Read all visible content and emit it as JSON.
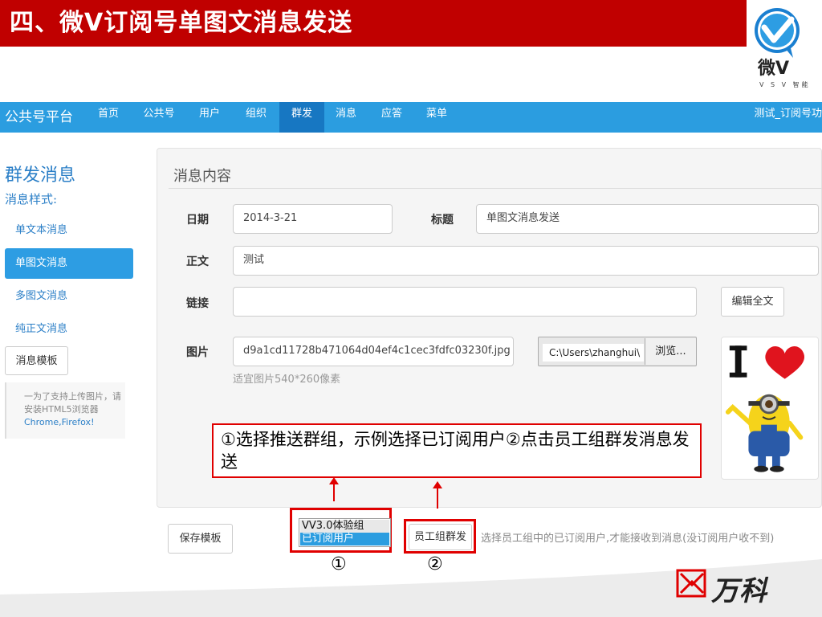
{
  "banner": {
    "title": "四、微V订阅号单图文消息发送"
  },
  "logo": {
    "text": "微V",
    "subtext": "V S V 智能"
  },
  "nav": {
    "brand": "公共号平台",
    "items": [
      "首页",
      "公共号",
      "用户",
      "组织",
      "群发",
      "消息",
      "应答",
      "菜单"
    ],
    "active": "群发",
    "right": "测试_订阅号功"
  },
  "sidebar": {
    "title": "群发消息",
    "subtitle": "消息样式:",
    "items": [
      "单文本消息",
      "单图文消息",
      "多图文消息",
      "纯正文消息"
    ],
    "active": "单图文消息",
    "template_button": "消息模板",
    "note_prefix": "一为了支持上传图片，请安装HTML5浏览器",
    "note_browsers": "Chrome,Firefox",
    "note_suffix": "!"
  },
  "panel": {
    "title": "消息内容",
    "date_label": "日期",
    "date_value": "2014-3-21",
    "subject_label": "标题",
    "subject_value": "单图文消息发送",
    "body_label": "正文",
    "body_value": "测试",
    "link_label": "链接",
    "link_value": "",
    "edit_full_button": "编辑全文",
    "image_label": "图片",
    "image_value": "d9a1cd11728b471064d04ef4c1cec3fdfc03230f.jpg",
    "file_path": "C:\\Users\\zhanghui\\",
    "browse_button": "浏览...",
    "image_hint": "适宜图片540*260像素"
  },
  "annotation": {
    "text": "①选择推送群组，示例选择已订阅用户②点击员工组群发消息发送",
    "marker1": "①",
    "marker2": "②"
  },
  "bottom": {
    "save_template_button": "保存模板",
    "group_options": [
      "VV3.0体验组",
      "已订阅用户"
    ],
    "selected_group": "已订阅用户",
    "group_send_button": "员工组群发",
    "hint": "选择员工组中的已订阅用户,才能接收到消息(没订阅用户收不到)"
  },
  "footer": {
    "brand": "万科"
  },
  "colors": {
    "banner": "#c00000",
    "nav": "#2b9de0",
    "nav_active": "#1777c2",
    "annotation": "#e00000"
  }
}
